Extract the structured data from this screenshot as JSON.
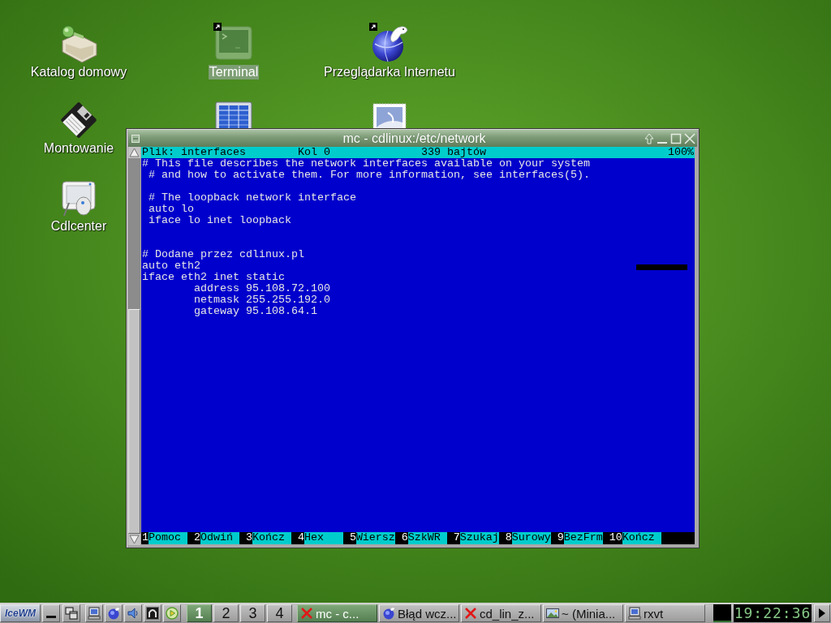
{
  "desktop": {
    "icons": [
      {
        "label": "Katalog domowy",
        "selected": false,
        "link": false
      },
      {
        "label": "Montowanie",
        "selected": false,
        "link": false
      },
      {
        "label": "Cdlcenter",
        "selected": false,
        "link": false
      },
      {
        "label": "Terminal",
        "selected": true,
        "link": true
      },
      {
        "selected": false,
        "link": false
      },
      {
        "label": "Przeglądarka Internetu",
        "selected": false,
        "link": true
      },
      {
        "selected": false,
        "link": false
      }
    ]
  },
  "window": {
    "title": "mc - cdlinux:/etc/network",
    "status": {
      "file": "Plik: interfaces",
      "column": "Kol 0",
      "size": "339 bajtów",
      "percent": "100%"
    },
    "lines": [
      {
        "kind": "text",
        "text": "# This file describes the network interfaces available on your system",
        "cursor": false
      },
      {
        "kind": "text",
        "text": " # and how to activate them. For more information, see interfaces(5).",
        "cursor": false
      },
      {
        "kind": "blank"
      },
      {
        "kind": "text",
        "text": " # The loopback network interface",
        "cursor": false
      },
      {
        "kind": "text",
        "text": " auto lo",
        "cursor": false
      },
      {
        "kind": "text",
        "text": " iface lo inet loopback",
        "cursor": false
      },
      {
        "kind": "blank"
      },
      {
        "kind": "blank"
      },
      {
        "kind": "text",
        "text": "# Dodane przez cdlinux.pl",
        "cursor": false
      },
      {
        "kind": "text",
        "text": "auto eth2",
        "cursor": true
      },
      {
        "kind": "text",
        "text": "iface eth2 inet static",
        "cursor": false
      },
      {
        "kind": "text",
        "text": "        address 95.108.72.100",
        "cursor": false
      },
      {
        "kind": "text",
        "text": "        netmask 255.255.192.0",
        "cursor": false
      },
      {
        "kind": "text",
        "text": "        gateway 95.108.64.1",
        "cursor": false
      }
    ],
    "function_keys": [
      {
        "key": "1",
        "label": "Pomoc"
      },
      {
        "key": "2",
        "label": "Odwiń"
      },
      {
        "key": "3",
        "label": "Kończ"
      },
      {
        "key": "4",
        "label": "Hex"
      },
      {
        "key": "5",
        "label": "Wiersz"
      },
      {
        "key": "6",
        "label": "SzkWR"
      },
      {
        "key": "7",
        "label": "Szukaj"
      },
      {
        "key": "8",
        "label": "Surowy"
      },
      {
        "key": "9",
        "label": "BezFrm"
      },
      {
        "key": "10",
        "label": "Kończ"
      }
    ]
  },
  "taskbar": {
    "start": "IceWM",
    "workspaces": [
      {
        "label": "1",
        "selected": true
      },
      {
        "label": "2",
        "selected": false
      },
      {
        "label": "3",
        "selected": false
      },
      {
        "label": "4",
        "selected": false
      }
    ],
    "tasks": [
      {
        "label": "mc - c...",
        "selected": true
      },
      {
        "label": "Błąd wcz...",
        "selected": false
      },
      {
        "label": "cd_lin_z...",
        "selected": false
      },
      {
        "label": "~ (Minia...",
        "selected": false
      },
      {
        "label": "rxvt",
        "selected": false
      }
    ],
    "clock": "19:22:36"
  }
}
